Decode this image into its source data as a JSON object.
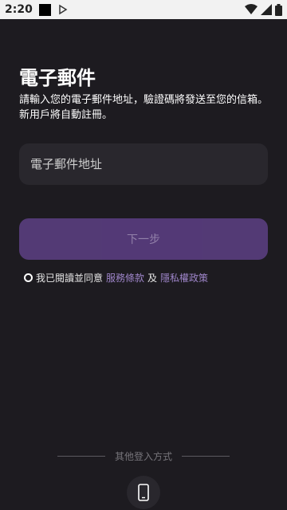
{
  "status_bar": {
    "time": "2:20"
  },
  "page": {
    "title": "電子郵件",
    "subtitle": "請輸入您的電子郵件地址，驗證碼將發送至您的信箱。新用戶將自動註冊。"
  },
  "form": {
    "email_placeholder": "電子郵件地址",
    "next_label": "下一步"
  },
  "agreement": {
    "prefix": "我已閱讀並同意",
    "terms_link": "服務條款",
    "and": "及",
    "privacy_link": "隱私權政策"
  },
  "other_login": {
    "label": "其他登入方式",
    "icons": [
      "phone-icon"
    ]
  },
  "colors": {
    "background": "#1d1b20",
    "field": "#29272d",
    "button": "#5d3f85",
    "link": "#9e85c9"
  }
}
